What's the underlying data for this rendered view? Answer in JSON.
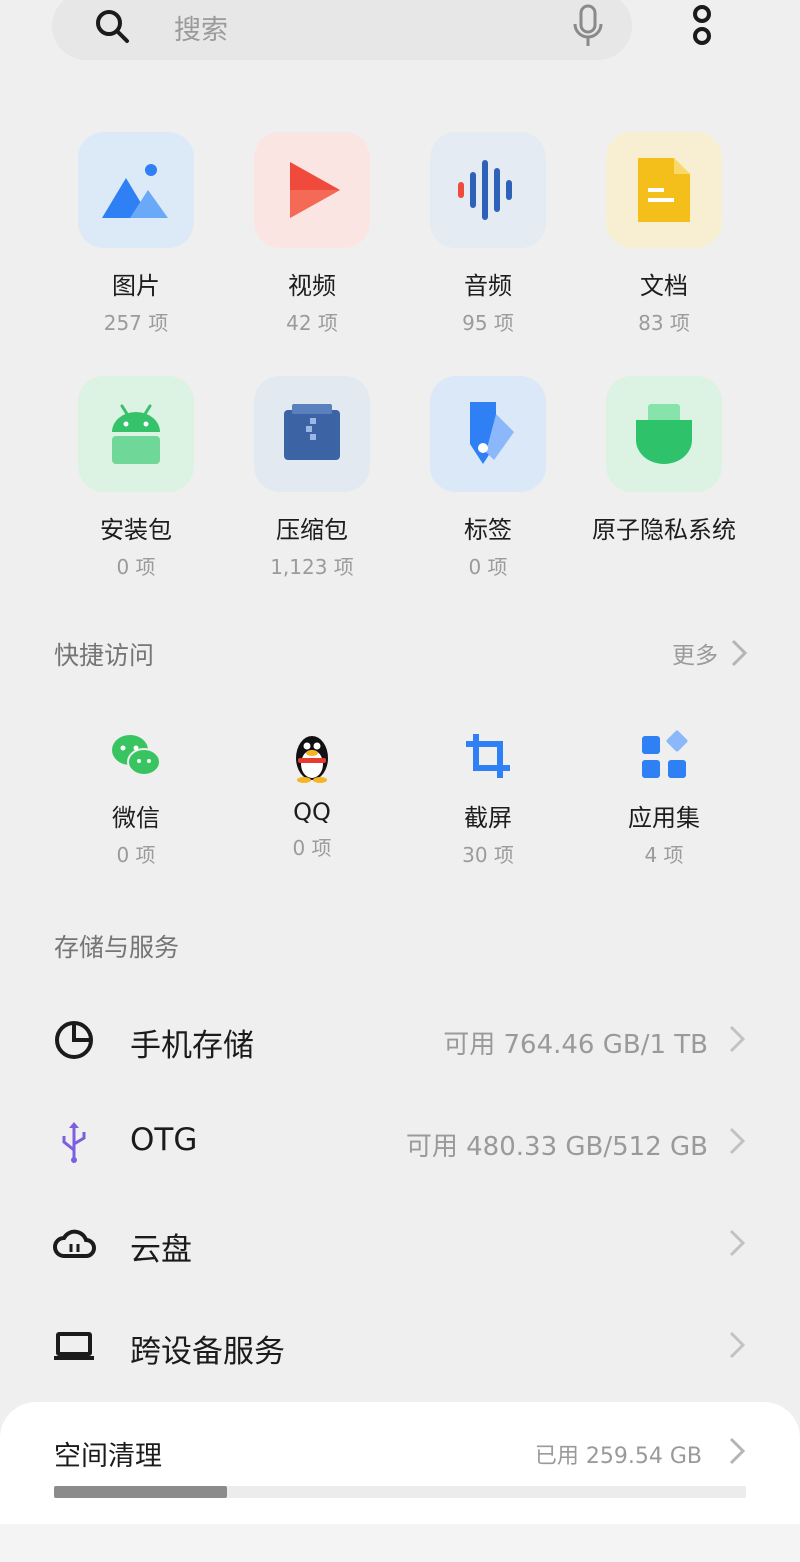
{
  "search": {
    "placeholder": "搜索"
  },
  "categories": [
    {
      "label": "图片",
      "count": "257 项",
      "icon": "image-icon"
    },
    {
      "label": "视频",
      "count": "42 项",
      "icon": "play-icon"
    },
    {
      "label": "音频",
      "count": "95 项",
      "icon": "audio-wave-icon"
    },
    {
      "label": "文档",
      "count": "83 项",
      "icon": "document-icon"
    },
    {
      "label": "安装包",
      "count": "0 项",
      "icon": "android-icon"
    },
    {
      "label": "压缩包",
      "count": "1,123 项",
      "icon": "zip-icon"
    },
    {
      "label": "标签",
      "count": "0 项",
      "icon": "tag-icon"
    },
    {
      "label": "原子隐私系统",
      "count": "",
      "icon": "privacy-shield-icon"
    }
  ],
  "quick_access": {
    "title": "快捷访问",
    "more": "更多",
    "items": [
      {
        "label": "微信",
        "count": "0 项",
        "icon": "wechat-icon"
      },
      {
        "label": "QQ",
        "count": "0 项",
        "icon": "qq-penguin-icon"
      },
      {
        "label": "截屏",
        "count": "30 项",
        "icon": "crop-icon"
      },
      {
        "label": "应用集",
        "count": "4 项",
        "icon": "app-grid-icon"
      }
    ]
  },
  "storage": {
    "title": "存储与服务",
    "rows": [
      {
        "label": "手机存储",
        "value": "可用 764.46 GB/1 TB",
        "icon": "pie-chart-icon"
      },
      {
        "label": "OTG",
        "value": "可用 480.33 GB/512 GB",
        "icon": "usb-icon"
      },
      {
        "label": "云盘",
        "value": "",
        "icon": "cloud-icon"
      },
      {
        "label": "跨设备服务",
        "value": "",
        "icon": "laptop-icon"
      }
    ]
  },
  "cleanup": {
    "title": "空间清理",
    "used": "已用 259.54 GB",
    "progress": 0.25
  },
  "colors": {
    "background": "#efefef",
    "accent_blue": "#2f7ff5",
    "green": "#35c26b"
  }
}
